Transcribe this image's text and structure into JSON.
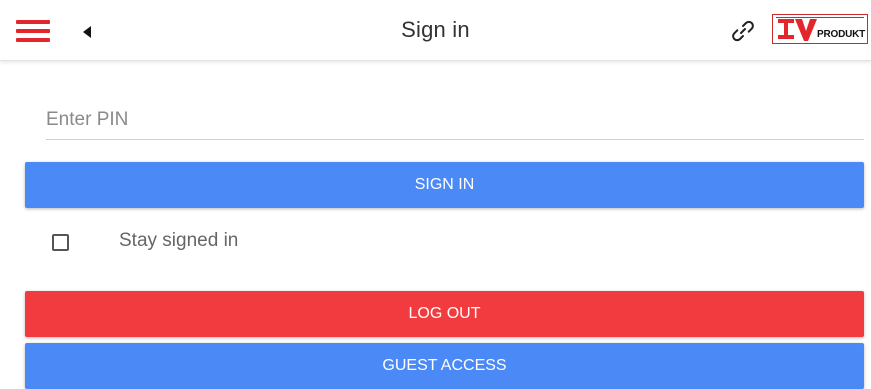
{
  "header": {
    "title": "Sign in",
    "menu_icon": "hamburger-menu-icon",
    "back_icon": "caret-left-icon",
    "link_icon": "link-icon",
    "logo": {
      "text": "IVPRODUKT",
      "accent_color": "#e3262b"
    }
  },
  "form": {
    "pin_placeholder": "Enter PIN",
    "pin_value": "",
    "signin_label": "SIGN IN",
    "stay_signed_in_label": "Stay signed in",
    "stay_signed_in_checked": false,
    "logout_label": "LOG OUT",
    "guest_label": "GUEST ACCESS"
  },
  "colors": {
    "primary_blue": "#4b89f7",
    "danger_red": "#f23b3f",
    "menu_red": "#e3262b"
  }
}
